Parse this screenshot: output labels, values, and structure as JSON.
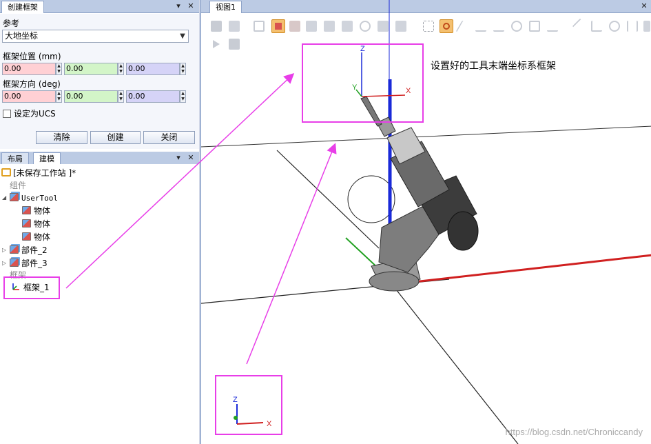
{
  "create_frame": {
    "title": "创建框架",
    "reference_label": "参考",
    "reference_value": "大地坐标",
    "position_label": "框架位置 (mm)",
    "position": {
      "x": "0.00",
      "y": "0.00",
      "z": "0.00"
    },
    "orientation_label": "框架方向 (deg)",
    "orientation": {
      "x": "0.00",
      "y": "0.00",
      "z": "0.00"
    },
    "ucs_label": "设定为UCS",
    "buttons": {
      "clear": "清除",
      "create": "创建",
      "close": "关闭"
    }
  },
  "browser": {
    "tabs": [
      "布局",
      "建模"
    ],
    "station": "[未保存工作站 ]*",
    "group_components": "组件",
    "user_tool": "UserTool",
    "body_label": "物体",
    "part2": "部件_2",
    "part3": "部件_3",
    "group_frames": "框架",
    "frame1": "框架_1"
  },
  "view": {
    "tab": "视图1",
    "annotation": "设置好的工具末端坐标系框架",
    "axis_x": "X",
    "axis_y": "Y",
    "axis_z": "Z",
    "watermark": "https://blog.csdn.net/Chroniccandy"
  },
  "colors": {
    "highlight": "#e83ee8",
    "axis_x": "#e02020",
    "axis_y": "#20a020",
    "axis_z": "#1a2ad8"
  }
}
